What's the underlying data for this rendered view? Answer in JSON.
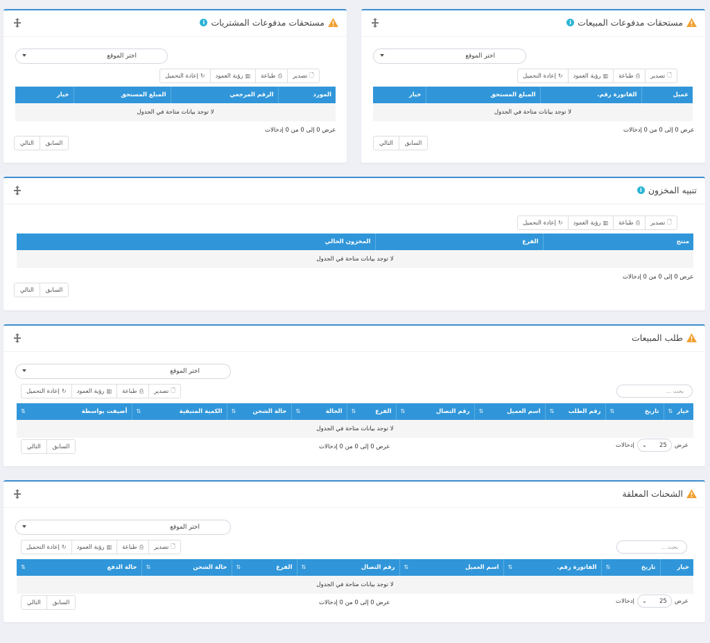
{
  "common": {
    "location_placeholder": "اختر الموقع",
    "export": "تصدير",
    "print": "طباعة",
    "column_visibility": "رؤية العمود",
    "reload": "إعادة التحميل",
    "no_data": "لا توجد بيانات متاحة في الجدول",
    "showing": "عرض 0 إلى 0 من 0 إدخالات",
    "previous": "السابق",
    "next": "التالي",
    "search_placeholder": "بحث ...",
    "show_label": "عرض",
    "entries_label": "إدخالات",
    "page_length": "25"
  },
  "sales_dues": {
    "title": "مستحقات مدفوعات المبيعات",
    "columns": [
      "عميل",
      "الفاتورة رقم.",
      "المبلغ المستحق",
      "خيار"
    ]
  },
  "purchase_dues": {
    "title": "مستحقات مدفوعات المشتريات",
    "columns": [
      "المورد",
      "الرقم المرجعي",
      "المبلغ المستحق",
      "خيار"
    ]
  },
  "stock_alert": {
    "title": "تنبيه المخزون",
    "columns": [
      "منتج",
      "الفرع",
      "المخزون الحالي"
    ]
  },
  "sales_order": {
    "title": "طلب المبيعات",
    "columns": [
      "خيار",
      "تاريخ",
      "رقم الطلب",
      "اسم العميل",
      "رقم التصال",
      "الفرع",
      "الحالة",
      "حالة الشحن",
      "الكمية المتبقية",
      "أضيفت بواسطة"
    ]
  },
  "pending_shipments": {
    "title": "الشحنات المعلقة",
    "columns": [
      "خيار",
      "تاريخ",
      "الفاتورة رقم.",
      "اسم العميل",
      "رقم التصال",
      "الفرع",
      "حالة الشحن",
      "حالة الدفع"
    ]
  }
}
